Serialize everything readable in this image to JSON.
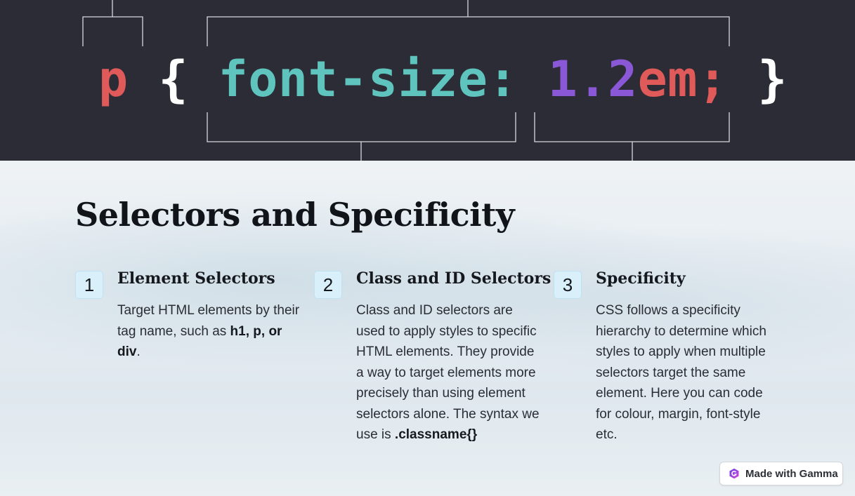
{
  "hero": {
    "code_tokens": {
      "selector": "p",
      "open_brace": "{",
      "property": "font-size:",
      "number": "1.2",
      "unit": "em;",
      "close_brace": "}"
    }
  },
  "slide": {
    "title": "Selectors and Specificity",
    "columns": [
      {
        "number": "1",
        "heading": "Element Selectors",
        "text_before": "Target HTML elements by their tag name, such as ",
        "text_bold": "h1, p, or div",
        "text_after": "."
      },
      {
        "number": "2",
        "heading": "Class and ID Selectors",
        "text_before": "Class and ID selectors are used to apply styles to specific HTML elements. They provide a way to target elements more precisely than using element selectors alone. The syntax we use is ",
        "text_bold": ".classname{}",
        "text_after": ""
      },
      {
        "number": "3",
        "heading": "Specificity",
        "text_before": "CSS follows a specificity hierarchy to determine which styles to apply when multiple selectors target the same element. Here you can code for colour, margin, font-style etc.",
        "text_bold": "",
        "text_after": ""
      }
    ]
  },
  "badge": {
    "label": "Made with Gamma",
    "icon": "gamma-logo-icon"
  },
  "colors": {
    "hero_bg": "#2b2c35",
    "selector": "#e05a5a",
    "property": "#5ec4bd",
    "number": "#8a57d6",
    "number_badge_bg": "#d9f0fb"
  }
}
